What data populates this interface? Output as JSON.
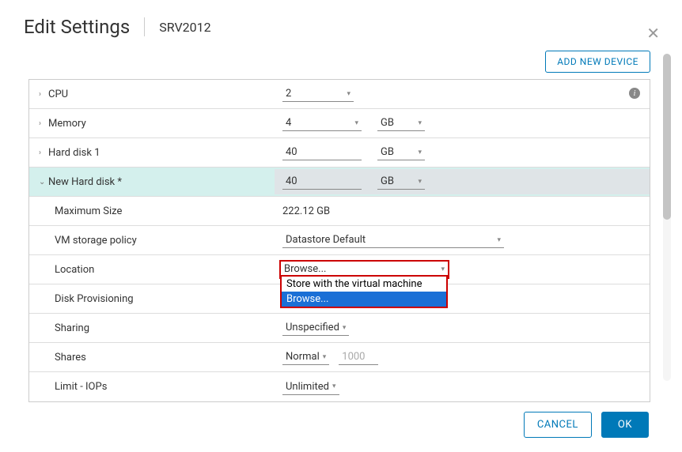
{
  "header": {
    "title": "Edit Settings",
    "vm_name": "SRV2012"
  },
  "toolbar": {
    "add_device": "ADD NEW DEVICE"
  },
  "rows": {
    "cpu": {
      "label": "CPU",
      "value": "2"
    },
    "memory": {
      "label": "Memory",
      "value": "4",
      "unit": "GB"
    },
    "hd1": {
      "label": "Hard disk 1",
      "value": "40",
      "unit": "GB"
    },
    "new_hd": {
      "label": "New Hard disk *",
      "value": "40",
      "unit": "GB"
    },
    "max_size": {
      "label": "Maximum Size",
      "value": "222.12 GB"
    },
    "vm_policy": {
      "label": "VM storage policy",
      "value": "Datastore Default"
    },
    "location": {
      "label": "Location",
      "value": "Browse..."
    },
    "disk_prov": {
      "label": "Disk Provisioning"
    },
    "sharing": {
      "label": "Sharing",
      "value": "Unspecified"
    },
    "shares": {
      "label": "Shares",
      "value": "Normal",
      "num": "1000"
    },
    "limit_iops": {
      "label": "Limit - IOPs",
      "value": "Unlimited"
    }
  },
  "dropdown": {
    "opt1": "Store with the virtual machine",
    "opt2": "Browse..."
  },
  "footer": {
    "cancel": "CANCEL",
    "ok": "OK"
  }
}
